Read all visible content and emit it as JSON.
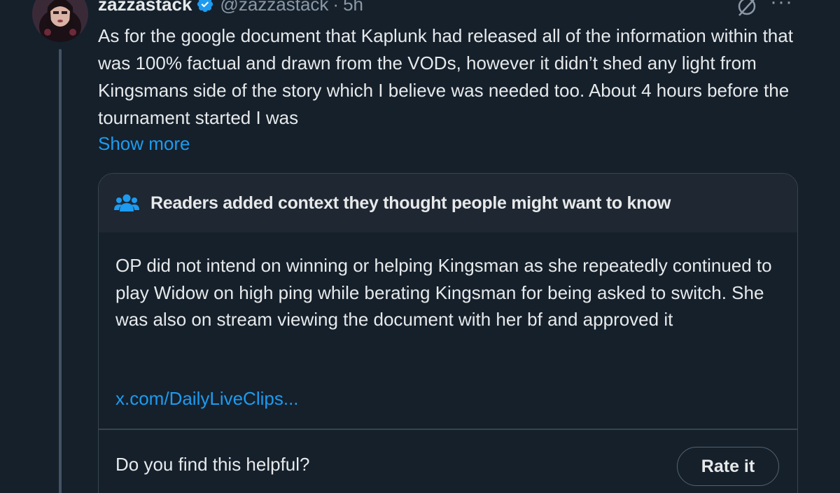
{
  "tweet": {
    "display_name": "zazzastack",
    "handle": "@zazzastack",
    "separator": "·",
    "timestamp": "5h",
    "verified_icon": "verified-badge-icon",
    "text": "As for the google document that Kaplunk had released all of the information within that was 100% factual and drawn from the VODs, however it didn’t shed any light from Kingsmans side of the story which I believe was needed too. About 4 hours before the tournament started I was",
    "show_more_label": "Show more",
    "more_icon_glyph": "···"
  },
  "community_note": {
    "title": "Readers added context they thought people might want to know",
    "icon": "people-icon",
    "text": "OP did not intend on winning or helping Kingsman as she repeatedly continued to play Widow on high ping while berating Kingsman for being asked to switch. She was also on stream viewing the document with her bf and approved it",
    "link": "x.com/DailyLiveClips...",
    "helpful_question": "Do you find this helpful?",
    "rate_button_label": "Rate it"
  },
  "colors": {
    "background": "#15202b",
    "accent": "#1d9bf0",
    "text_primary": "#e7e9ea",
    "text_secondary": "#8b98a5",
    "border": "#38444d",
    "note_header_bg": "#1e2732"
  }
}
